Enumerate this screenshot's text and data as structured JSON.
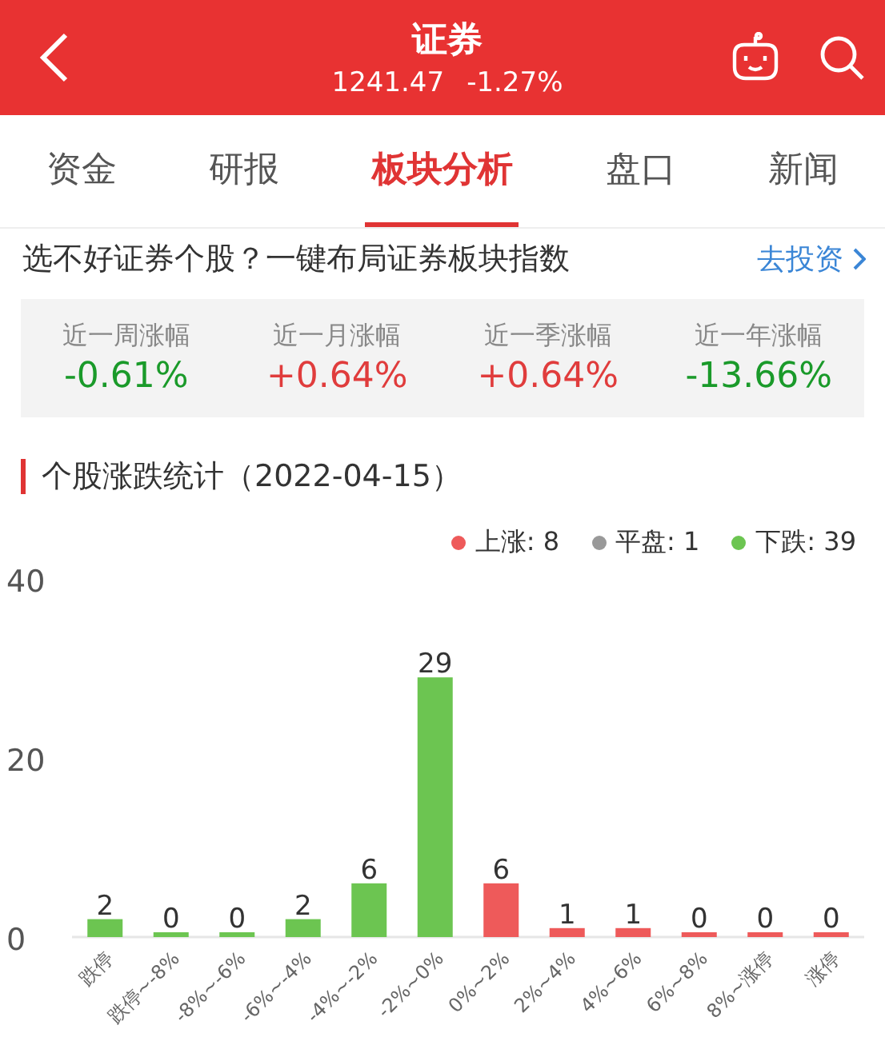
{
  "header": {
    "title": "证券",
    "price": "1241.47",
    "change": "-1.27%"
  },
  "tabs": [
    {
      "label": "资金",
      "selected": false
    },
    {
      "label": "研报",
      "selected": false
    },
    {
      "label": "板块分析",
      "selected": true
    },
    {
      "label": "盘口",
      "selected": false
    },
    {
      "label": "新闻",
      "selected": false
    }
  ],
  "promo": {
    "text": "选不好证券个股？一键布局证券板块指数",
    "link": "去投资"
  },
  "stats": [
    {
      "label": "近一周涨幅",
      "value": "-0.61%",
      "kind": "down"
    },
    {
      "label": "近一月涨幅",
      "value": "+0.64%",
      "kind": "up"
    },
    {
      "label": "近一季涨幅",
      "value": "+0.64%",
      "kind": "up"
    },
    {
      "label": "近一年涨幅",
      "value": "-13.66%",
      "kind": "down"
    }
  ],
  "section_title": "个股涨跌统计（2022-04-15）",
  "legend": [
    {
      "label": "上涨: 8",
      "color": "#ee5a5a"
    },
    {
      "label": "平盘: 1",
      "color": "#999999"
    },
    {
      "label": "下跌: 39",
      "color": "#6cc551"
    }
  ],
  "chart_data": {
    "type": "bar",
    "categories": [
      "跌停",
      "跌停~-8%",
      "-8%~-6%",
      "-6%~-4%",
      "-4%~-2%",
      "-2%~0%",
      "0%~2%",
      "2%~4%",
      "4%~6%",
      "6%~8%",
      "8%~涨停",
      "涨停"
    ],
    "series": [
      {
        "color": "#6cc551",
        "values": [
          2,
          0,
          0,
          2,
          6,
          29,
          null,
          null,
          null,
          null,
          null,
          null
        ]
      },
      {
        "color": "#ee5a5a",
        "values": [
          null,
          null,
          null,
          null,
          null,
          null,
          6,
          1,
          1,
          0,
          0,
          0
        ]
      }
    ],
    "ylim": [
      0,
      40
    ],
    "yticks": [
      0,
      20,
      40
    ],
    "data_labels": true
  }
}
